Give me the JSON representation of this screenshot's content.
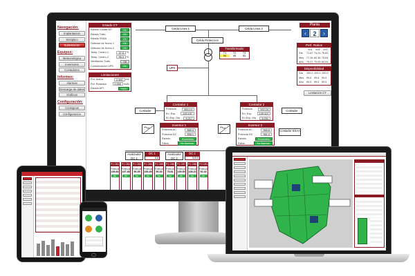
{
  "colors": {
    "brand_red": "#8a1b24",
    "ok_green": "#2fb34a",
    "plant_blue": "#2b5ea8"
  },
  "nav": {
    "sections": [
      {
        "title": "Navegación:",
        "items": [
          {
            "label": "Implantacion",
            "active": false
          },
          {
            "label": "Sinóptico",
            "active": false
          },
          {
            "label": "Subestacion",
            "active": true
          }
        ]
      },
      {
        "title": "Equipos:",
        "items": [
          {
            "label": "Meteorológica"
          },
          {
            "label": "Inversores"
          },
          {
            "label": "Contadores"
          }
        ]
      },
      {
        "title": "Informes:",
        "items": [
          {
            "label": "Alarmas"
          },
          {
            "label": "Descarga de datos"
          },
          {
            "label": "Graficas"
          }
        ]
      },
      {
        "title": "Configuración:",
        "items": [
          {
            "label": "Consignas"
          },
          {
            "label": "Configuracion"
          }
        ]
      }
    ]
  },
  "estado_ct": {
    "title": "Estado CT",
    "rows": [
      {
        "label": "Estado Celdas MT",
        "value": "OK"
      },
      {
        "label": "Estado Trafo",
        "value": "OK"
      },
      {
        "label": "Estado SSAA",
        "value": "OK"
      },
      {
        "label": "Detector de Humo 1",
        "value": "OK"
      },
      {
        "label": "Detector de Humo 2",
        "value": "OK"
      },
      {
        "label": "Temp. Centro 1",
        "value": "37.3",
        "unit": "ºC"
      },
      {
        "label": "Temp. Centro 2",
        "value": "35.3",
        "unit": "ºC"
      },
      {
        "label": "Ventilacion Trafo",
        "value": "Off"
      },
      {
        "label": "Comunicacion UPS",
        "value": "OK"
      }
    ]
  },
  "limitaciones": {
    "title": "Limitaciones",
    "rows": [
      {
        "label": "Pot. Activa",
        "value": "2.400",
        "unit": "kW"
      },
      {
        "label": "Pot. Reactiva",
        "value": "0.000",
        "unit": "kVAr"
      },
      {
        "label": "Estado API",
        "value": "RUN"
      }
    ]
  },
  "single_line": {
    "celda1": "Celda Linea 1",
    "celda2": "Celda Linea 2",
    "proteccion": "Celda Proteccion",
    "transformador": "Transformador",
    "trafo_cols": [
      "T1",
      "T2",
      "T3"
    ],
    "trafo_vals": [
      "94",
      "98",
      "83"
    ],
    "ups": "UPS",
    "ups_value": "2.17",
    "contador": "Contador",
    "contador_ssaa": "Contador SSAA",
    "contador1": {
      "title": "Contador 1",
      "rows": [
        {
          "label": "Potencia",
          "value": "864.14"
        },
        {
          "label": "En. Exp.",
          "value": "145.157"
        },
        {
          "label": "En.Exp. Dia",
          "value": "5,217"
        }
      ]
    },
    "contador2": {
      "title": "Contador 2",
      "rows": [
        {
          "label": "Potencia",
          "value": "922.24"
        },
        {
          "label": "En. Exp.",
          "value": "145.112"
        },
        {
          "label": "En.Exp. Dia",
          "value": "5,201"
        }
      ]
    },
    "inversor1": {
      "title": "Inversor 1",
      "rows": [
        {
          "label": "Potencia AC",
          "value": "889.4"
        },
        {
          "label": "Potencia DC",
          "value": "896.1"
        },
        {
          "label": "Estado",
          "value": "Encendido"
        },
        {
          "label": "Fallos",
          "value": "No Alarmas"
        }
      ]
    },
    "inversor2": {
      "title": "Inversor 2",
      "rows": [
        {
          "label": "Potencia AC",
          "value": "960.6"
        },
        {
          "label": "Potencia DC",
          "value": "961.4"
        },
        {
          "label": "Estado",
          "value": "Encendido"
        },
        {
          "label": "Fallos",
          "value": "No Alarmas"
        }
      ]
    },
    "analizadores": [
      {
        "label": "Analizador DC 1",
        "dc": "DC 1",
        "pot": "0.0"
      },
      {
        "label": "Analizador DC 2",
        "dc": "DC 2",
        "pot": "115.9"
      },
      {
        "label": "Analizador DC 3",
        "dc": "DC 3",
        "pot": "0.0"
      },
      {
        "label": "Analizador DC 4",
        "dc": "DC 4",
        "pot": "413.3"
      }
    ],
    "strings": [
      {
        "head": "P.1.CB1",
        "label": "Potencia",
        "value": "135.84",
        "state": "OK"
      },
      {
        "head": "P.1.CB2",
        "label": "Potencia",
        "value": "147.48",
        "state": "OK"
      },
      {
        "head": "P.1.CB3",
        "label": "Potencia",
        "value": "96.35",
        "state": "OK"
      },
      {
        "head": "P.1.CB4",
        "label": "Potencia",
        "value": "153.45",
        "state": "OK"
      },
      {
        "head": "P.1.CB5",
        "label": "Potencia",
        "value": "96.33",
        "state": "OK"
      },
      {
        "head": "P.1.CB6",
        "label": "Potencia",
        "value": "75.81",
        "state": "OK"
      },
      {
        "head": "P.1.CB7",
        "label": "Potencia",
        "value": "135.05",
        "state": "OK"
      },
      {
        "head": "P.1.CB8",
        "label": "Potencia",
        "value": "128.22",
        "state": "OK"
      },
      {
        "head": "P.2.CB1",
        "label": "Potencia",
        "value": "92.18",
        "state": "OK"
      }
    ]
  },
  "planta": {
    "title": "Planta",
    "number": "2",
    "prev": "‹",
    "next": "›"
  },
  "perf_ratio": {
    "title": "Perf. Ratios",
    "cols": [
      "Inv1",
      "Inv2",
      "Inv3"
    ],
    "rows": [
      {
        "label": "Dia",
        "v": [
          "71.87",
          "74.21",
          "76.81"
        ]
      },
      {
        "label": "Mes",
        "v": [
          "77.26",
          "82.36",
          "79.64"
        ]
      },
      {
        "label": "Año",
        "v": [
          "79.27",
          "79.93",
          "82.61"
        ]
      }
    ]
  },
  "disponibilidad": {
    "title": "Disponibilidad",
    "rows": [
      {
        "label": "Dia",
        "v": [
          "100.0",
          "100.0",
          "100.0"
        ]
      },
      {
        "label": "Mes",
        "v": [
          "99.6",
          "99.6",
          "99.6"
        ]
      },
      {
        "label": "Año",
        "v": [
          "99.5",
          "99.5",
          "99.5"
        ]
      }
    ]
  },
  "limitacion_btn": "Limitacion CT",
  "laptop": {
    "ok_label": "OK"
  }
}
